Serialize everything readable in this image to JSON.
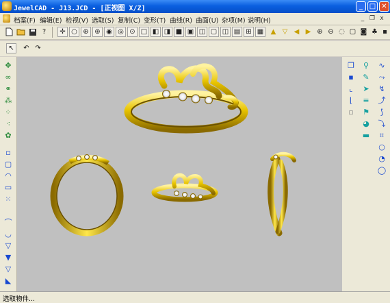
{
  "window": {
    "title": "JewelCAD - J13.JCD - [正视图 X/Z]",
    "minimize": "_",
    "maximize": "□",
    "close": "✕"
  },
  "menu": {
    "items": [
      "档案(F)",
      "编辑(E)",
      "检视(V)",
      "选取(S)",
      "复制(C)",
      "变形(T)",
      "曲线(R)",
      "曲面(U)",
      "杂项(M)",
      "说明(H)"
    ],
    "mdi_minimize": "_",
    "mdi_restore": "❐",
    "mdi_close": "x"
  },
  "colors": {
    "gold_light": "#fff3a0",
    "gold_mid": "#e8c400",
    "gold_dark": "#8a6a00",
    "viewport_bg": "#c0c0c0",
    "titlebar": "#0a5fe0"
  },
  "statusbar": {
    "text": "选取物件..."
  }
}
